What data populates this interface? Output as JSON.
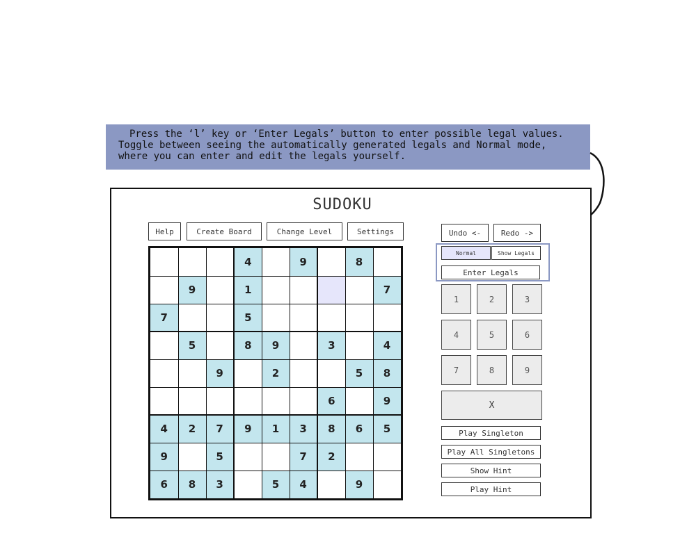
{
  "banner": {
    "line1": "Press the ‘l’ key or ‘Enter Legals’ button to enter possible legal values.",
    "line2": "Toggle between seeing the automatically generated legals and Normal mode,",
    "line3": "where you can enter and edit the legals yourself."
  },
  "app": {
    "title": "SUDOKU"
  },
  "toolbar": {
    "help": "Help",
    "create_board": "Create Board",
    "change_level": "Change Level",
    "settings": "Settings",
    "undo": "Undo <-",
    "redo": "Redo ->"
  },
  "legals": {
    "normal": "Normal",
    "show_legals": "Show Legals",
    "enter_legals": "Enter Legals"
  },
  "keypad": {
    "digits": [
      "1",
      "2",
      "3",
      "4",
      "5",
      "6",
      "7",
      "8",
      "9"
    ],
    "clear": "X"
  },
  "actions": {
    "play_singleton": "Play Singleton",
    "play_all_singletons": "Play All Singletons",
    "show_hint": "Show Hint",
    "play_hint": "Play Hint"
  },
  "board": {
    "cells": [
      [
        "",
        "",
        "",
        "4",
        "",
        "9",
        "",
        "8",
        ""
      ],
      [
        "",
        "9",
        "",
        "1",
        "",
        "",
        "",
        "",
        "7"
      ],
      [
        "7",
        "",
        "",
        "5",
        "",
        "",
        "",
        "",
        ""
      ],
      [
        "",
        "5",
        "",
        "8",
        "9",
        "",
        "3",
        "",
        "4"
      ],
      [
        "",
        "",
        "9",
        "",
        "2",
        "",
        "",
        "5",
        "8"
      ],
      [
        "",
        "",
        "",
        "",
        "",
        "",
        "6",
        "",
        "9"
      ],
      [
        "4",
        "2",
        "7",
        "9",
        "1",
        "3",
        "8",
        "6",
        "5"
      ],
      [
        "9",
        "",
        "5",
        "",
        "",
        "7",
        "2",
        "",
        ""
      ],
      [
        "6",
        "8",
        "3",
        "",
        "5",
        "4",
        "",
        "9",
        ""
      ]
    ],
    "selected": [
      1,
      6
    ],
    "colors": {
      "given": "#c3e6ee",
      "selected": "#e6e6fb",
      "banner": "#8b98c3"
    }
  }
}
